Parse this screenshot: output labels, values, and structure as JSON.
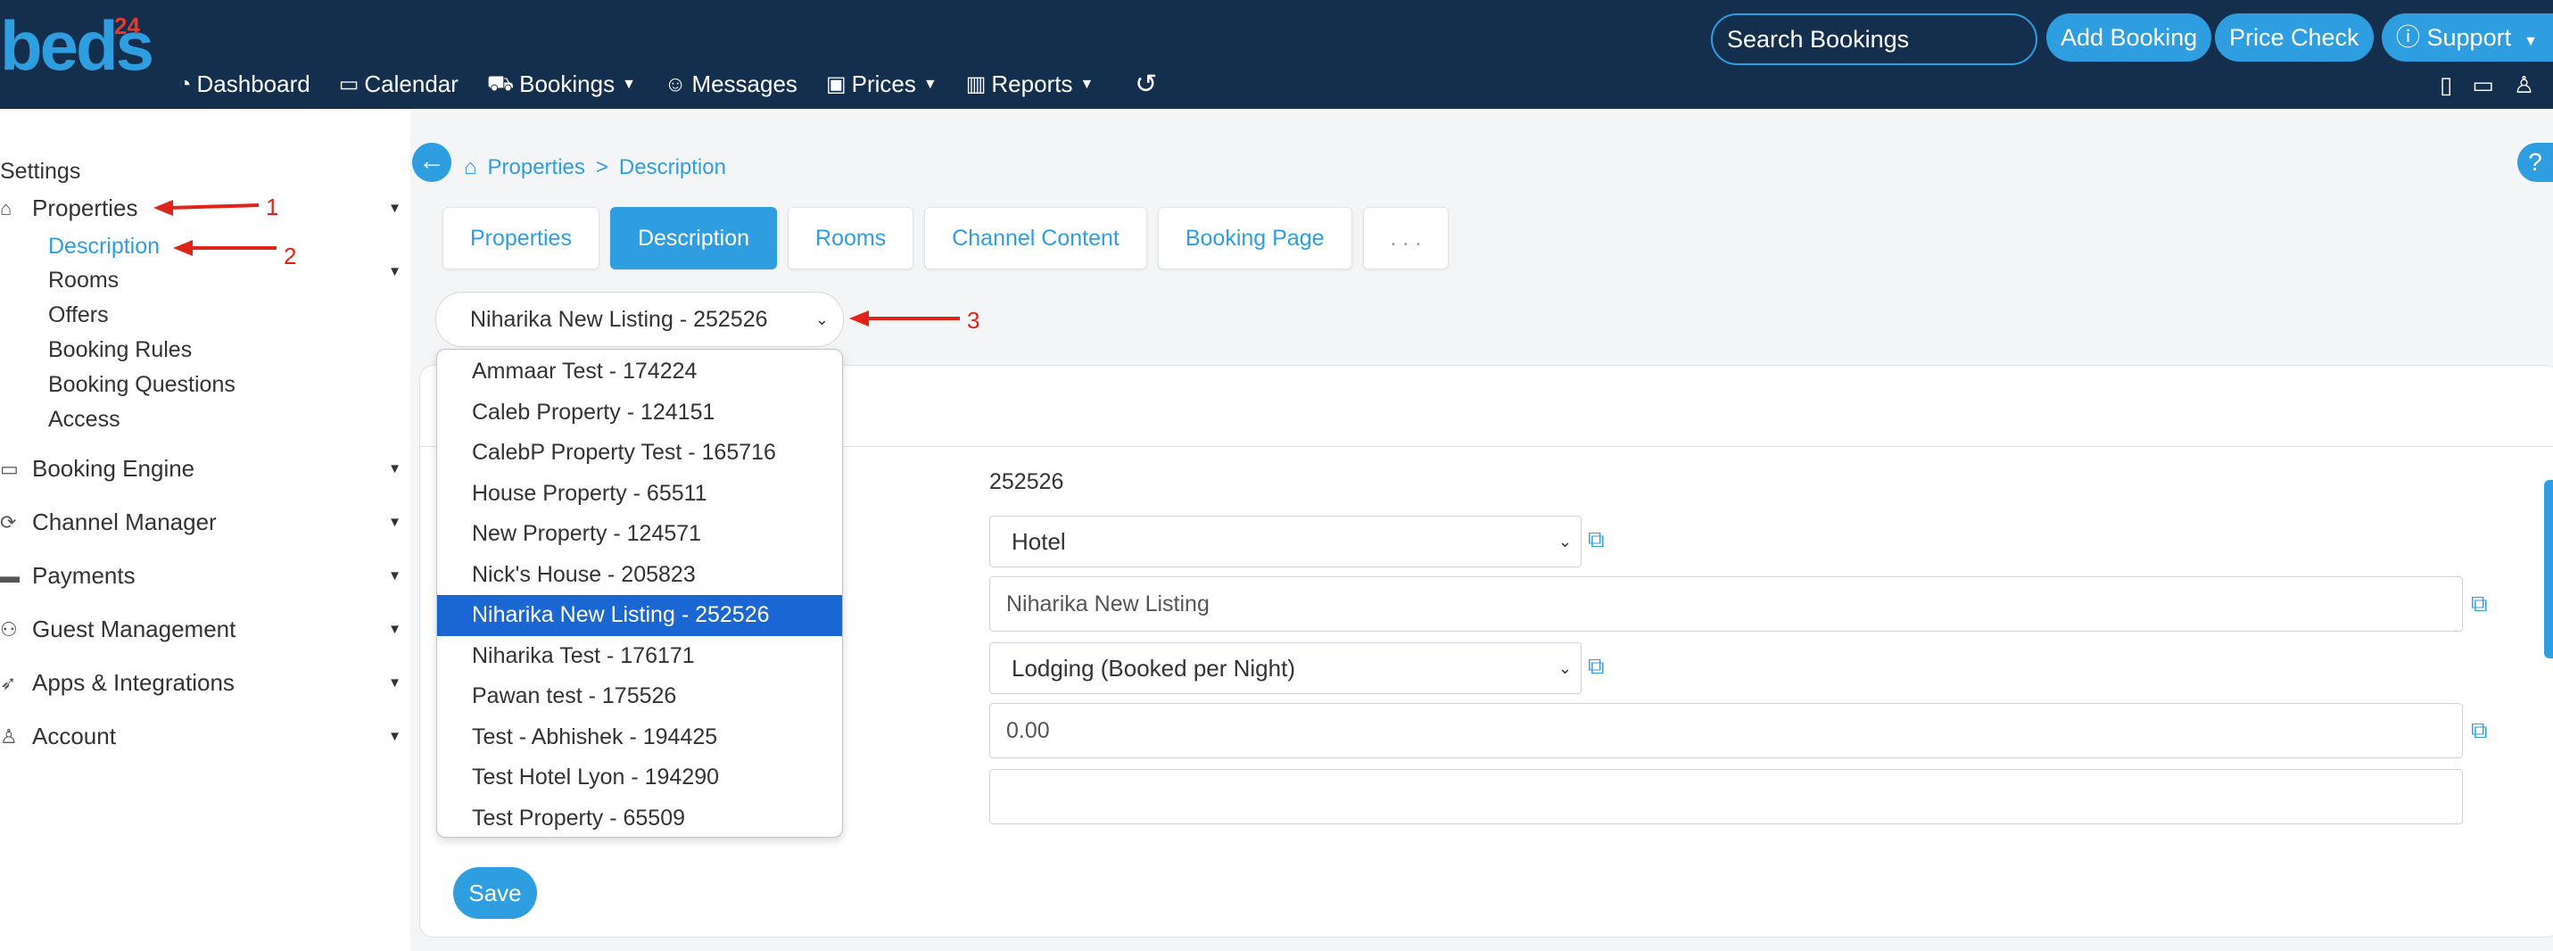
{
  "brand": {
    "logo_text": "beds",
    "logo_sup": "24"
  },
  "topnav": [
    {
      "icon": "dashboard-icon",
      "glyph": "◔",
      "label": "Dashboard",
      "caret": false
    },
    {
      "icon": "calendar-icon",
      "glyph": "▭",
      "label": "Calendar",
      "caret": false
    },
    {
      "icon": "bed-icon",
      "glyph": "⛟",
      "label": "Bookings",
      "caret": true
    },
    {
      "icon": "messages-icon",
      "glyph": "☺",
      "label": "Messages",
      "caret": false
    },
    {
      "icon": "money-icon",
      "glyph": "▣",
      "label": "Prices",
      "caret": true
    },
    {
      "icon": "chart-icon",
      "glyph": "▥",
      "label": "Reports",
      "caret": true
    },
    {
      "icon": "history-icon",
      "glyph": "↺",
      "label": "",
      "caret": false
    }
  ],
  "search": {
    "placeholder": "Search Bookings"
  },
  "actions": {
    "add_booking": "Add Booking",
    "price_check": "Price Check",
    "support": "Support"
  },
  "sidebar": {
    "settings_label": "Settings",
    "properties": "Properties",
    "properties_sub": [
      "Description",
      "Rooms",
      "Offers",
      "Booking Rules",
      "Booking Questions",
      "Access"
    ],
    "sections": [
      {
        "icon": "monitor-icon",
        "glyph": "▭",
        "label": "Booking Engine"
      },
      {
        "icon": "sync-icon",
        "glyph": "⟳",
        "label": "Channel Manager"
      },
      {
        "icon": "card-icon",
        "glyph": "▬",
        "label": "Payments"
      },
      {
        "icon": "users-icon",
        "glyph": "⚇",
        "label": "Guest Management"
      },
      {
        "icon": "rocket-icon",
        "glyph": "➶",
        "label": "Apps & Integrations"
      },
      {
        "icon": "user-icon",
        "glyph": "♙",
        "label": "Account"
      }
    ]
  },
  "breadcrumb": {
    "root": "Properties",
    "sep": ">",
    "current": "Description"
  },
  "tabs": [
    "Properties",
    "Description",
    "Rooms",
    "Channel Content",
    "Booking Page",
    ". . ."
  ],
  "active_tab": "Description",
  "property_select": {
    "value": "Niharika New Listing - 252526",
    "options": [
      "Ammaar Test - 174224",
      "Caleb Property - 124151",
      "CalebP Property Test - 165716",
      "House Property - 65511",
      "New Property - 124571",
      "Nick's House - 205823",
      "Niharika New Listing - 252526",
      "Niharika Test - 176171",
      "Pawan test - 175526",
      "Test - Abhishek - 194425",
      "Test Hotel Lyon - 194290",
      "Test Property - 65509"
    ]
  },
  "form": {
    "property_id": "252526",
    "property_type": "Hotel",
    "property_name": "Niharika New Listing",
    "booking_type": "Lodging (Booked per Night)",
    "amount": "0.00",
    "empty_field": ""
  },
  "save_label": "Save",
  "annotations": {
    "first": "1",
    "second": "2",
    "third": "3",
    "color": "#e0241a"
  },
  "colors": {
    "topbar": "#142f4d",
    "accent": "#2f9ee0",
    "selected_option": "#1a66d2"
  }
}
